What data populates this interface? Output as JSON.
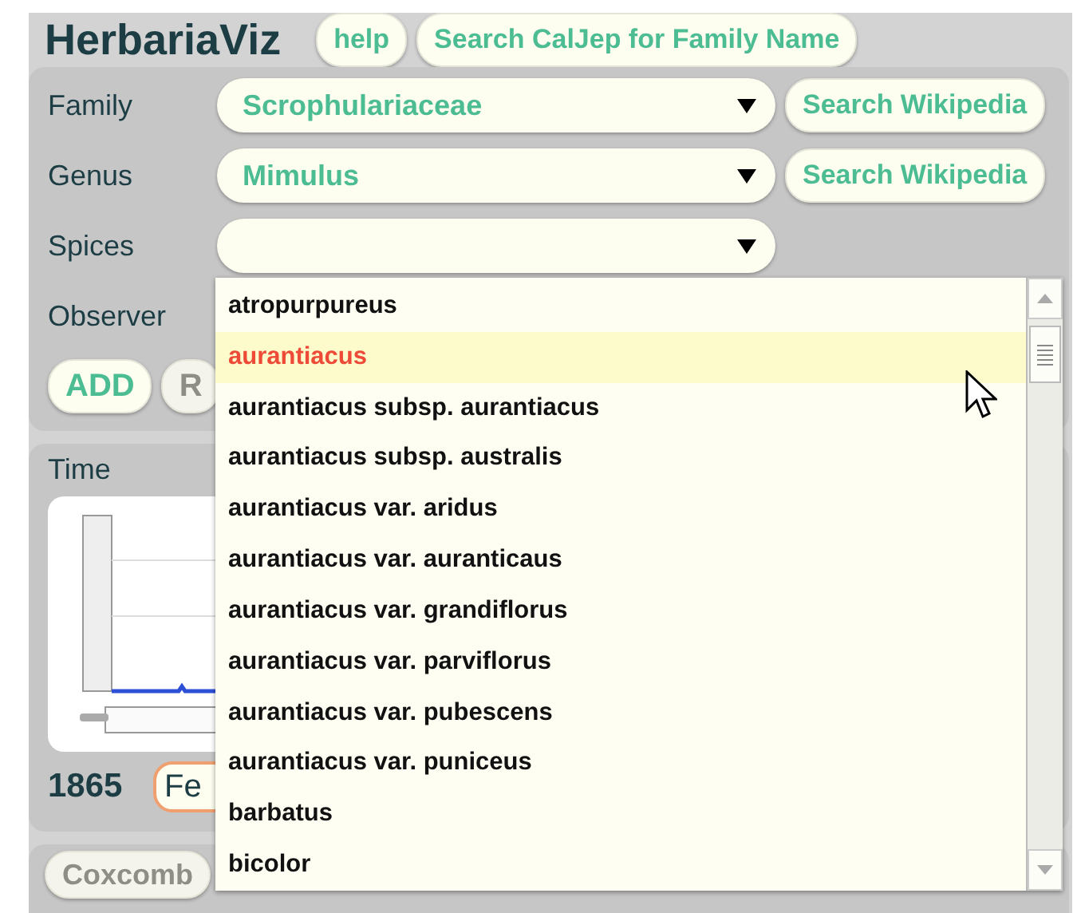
{
  "app": {
    "title": "HerbariaViz"
  },
  "header_buttons": [
    "help",
    "Search CalJep for Family Name"
  ],
  "form_rows": [
    {
      "kind": "select",
      "label": "Family",
      "value": "Scrophulariaceae",
      "button": "Search Wikipedia"
    },
    {
      "kind": "select",
      "label": "Genus",
      "value": "Mimulus",
      "button": "Search Wikipedia"
    },
    {
      "kind": "select",
      "label": "Spices",
      "value": ""
    },
    {
      "kind": "text",
      "label": "Observer"
    }
  ],
  "action_buttons": [
    "ADD",
    "R"
  ],
  "time_panel": {
    "label": "Time",
    "year": "1865",
    "field_value": "Fe"
  },
  "bottom_button": {
    "label": "Coxcomb",
    "disabled": true
  },
  "species_dropdown": {
    "items": [
      {
        "label": "atropurpureus",
        "selected": false
      },
      {
        "label": "aurantiacus",
        "selected": true
      },
      {
        "label": "aurantiacus subsp. aurantiacus",
        "selected": false
      },
      {
        "label": "aurantiacus subsp. australis",
        "selected": false
      },
      {
        "label": "aurantiacus var. aridus",
        "selected": false
      },
      {
        "label": "aurantiacus var. auranticaus",
        "selected": false
      },
      {
        "label": "aurantiacus var. grandiflorus",
        "selected": false
      },
      {
        "label": "aurantiacus var. parviflorus",
        "selected": false
      },
      {
        "label": "aurantiacus var. pubescens",
        "selected": false
      },
      {
        "label": "aurantiacus var. puniceus",
        "selected": false
      },
      {
        "label": "barbatus",
        "selected": false
      },
      {
        "label": "bicolor",
        "selected": false
      }
    ]
  }
}
